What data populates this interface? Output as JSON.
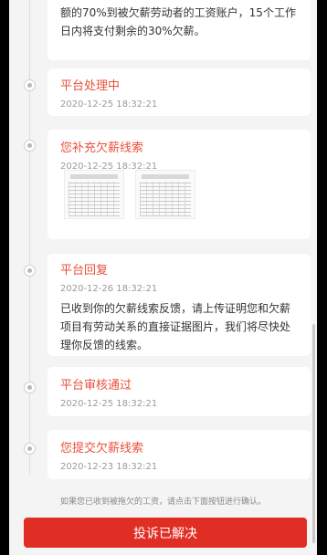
{
  "top_card": {
    "lines": [
      "额的70%到被欠薪劳动者的工资账户，15个工作",
      "日内将支付剩余的30%欠薪。"
    ]
  },
  "timeline": [
    {
      "title": "平台处理中",
      "time": "2020-12-25 18:32:21"
    },
    {
      "title": "您补充欠薪线索",
      "time": "2020-12-25 18:32:21"
    },
    {
      "title": "平台回复",
      "time": "2020-12-26 18:32:21",
      "body": "已收到你的欠薪线索反馈，请上传证明您和欠薪项目有劳动关系的直接证据图片，我们将尽快处理你反馈的线索。"
    },
    {
      "title": "平台审核通过",
      "time": "2020-12-25 18:32:21"
    },
    {
      "title": "您提交欠薪线索",
      "time": "2020-12-23 18:32:21"
    }
  ],
  "footer": {
    "note": "如果您已收到被拖欠的工资，请点击下面按钮进行确认。",
    "button_label": "投诉已解决"
  },
  "colors": {
    "accent": "#e12e25",
    "title_red": "#e8503a"
  }
}
